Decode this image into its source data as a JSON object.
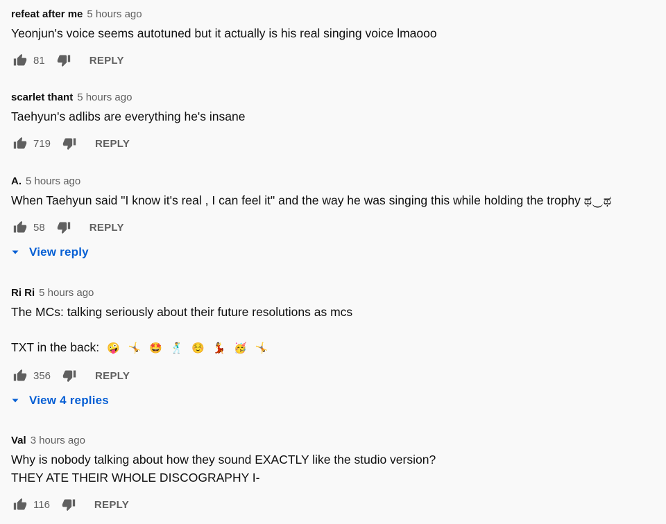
{
  "comments": [
    {
      "author": "refeat after me",
      "time": "5 hours ago",
      "lines": [
        "Yeonjun's voice seems autotuned but it actually is his real singing voice lmaooo"
      ],
      "likes": "81",
      "reply_label": "REPLY"
    },
    {
      "author": "scarlet thant",
      "time": "5 hours ago",
      "lines": [
        "Taehyun's adlibs are everything he's insane"
      ],
      "likes": "719",
      "reply_label": "REPLY"
    },
    {
      "author": "A.",
      "time": "5 hours ago",
      "lines": [
        "When Taehyun said \"I know it's real , I can feel it\" and the way he was singing this while holding the trophy ಥ‿ಥ"
      ],
      "likes": "58",
      "reply_label": "REPLY",
      "view_replies": "View reply"
    },
    {
      "author": "Ri Ri",
      "time": "5 hours ago",
      "lines": [
        "The MCs: talking seriously about their future resolutions as mcs",
        "",
        "TXT in the back:"
      ],
      "emojis": [
        "🤪",
        "🤸",
        "🤩",
        "🕺",
        "☺️",
        "💃",
        "🥳",
        "🤸"
      ],
      "likes": "356",
      "reply_label": "REPLY",
      "view_replies": "View 4 replies"
    },
    {
      "author": "Val",
      "time": "3 hours ago",
      "lines": [
        "Why is nobody talking about how they sound EXACTLY like the studio version?",
        "THEY ATE THEIR WHOLE DISCOGRAPHY I-"
      ],
      "likes": "116",
      "reply_label": "REPLY"
    }
  ],
  "icons": {
    "like": "thumb-up-icon",
    "dislike": "thumb-down-icon",
    "expand": "caret-down-icon"
  },
  "colors": {
    "link_blue": "#065fd4",
    "secondary_text": "#606060",
    "icon": "#606060"
  }
}
